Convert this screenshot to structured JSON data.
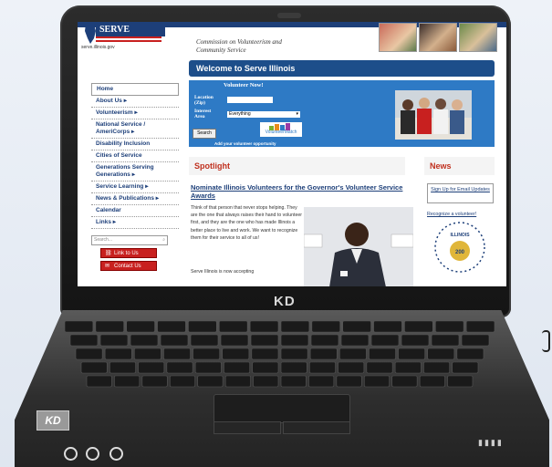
{
  "device": {
    "brand": "KD",
    "badge": "KD"
  },
  "site": {
    "logo_text": "SERVE ILLINOIS",
    "url": "serve.illinois.gov",
    "commission_line1": "Commission on Volunteerism and",
    "commission_line2": "Community Service",
    "welcome": "Welcome to Serve Illinois",
    "nav": [
      "Home",
      "About Us  ▸",
      "Volunteerism  ▸",
      "National Service / AmeriCorps  ▸",
      "Disability Inclusion",
      "Cities of Service",
      "Generations Serving Generations  ▸",
      "Service Learning  ▸",
      "News & Publications  ▸",
      "Calendar",
      "Links  ▸"
    ],
    "search_placeholder": "Search...",
    "link_to_us": "Link to Us",
    "contact_us": "Contact Us",
    "volunteer": {
      "title": "Volunteer Now!",
      "location_label": "Location (Zip)",
      "interest_label": "Interest Area",
      "interest_value": "Everything",
      "search_button": "Search",
      "powered_by": "VolunteerMatch",
      "add_link": "Add your volunteer opportunity"
    },
    "spotlight": "Spotlight",
    "news": "News",
    "article": {
      "title": "Nominate Illinois Volunteers for the Governor's Volunteer Service Awards",
      "body": "Think of that person that never stops helping. They are the one that always raises their hand to volunteer first, and they are the one who has made Illinois a better place to live and work. We want to recognize them for their service to all of us!",
      "body2": "Serve Illinois is now accepting"
    },
    "signup": "Sign Up for Email Updates",
    "recognize": "Recognize a volunteer!",
    "seal_text": "ILLINOIS"
  },
  "colors": {
    "navy": "#1d3f79",
    "accent_red": "#c0301e",
    "panel_blue": "#2e7ac5"
  }
}
